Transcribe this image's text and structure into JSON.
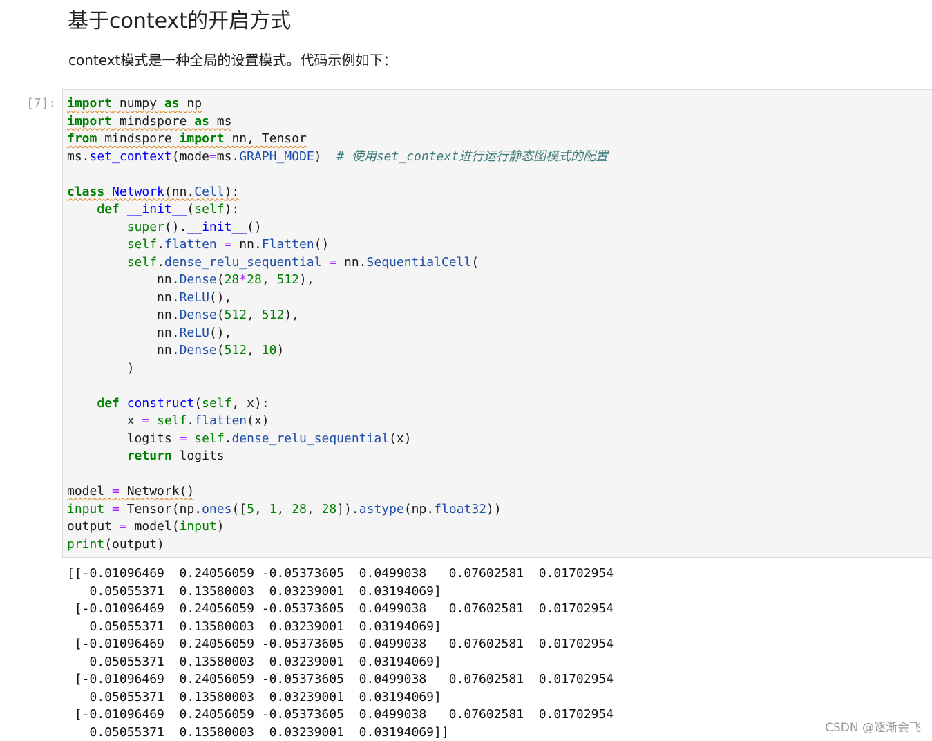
{
  "heading": "基于context的开启方式",
  "paragraph": "context模式是一种全局的设置模式。代码示例如下：",
  "cell": {
    "prompt": "[7]:",
    "lines": [
      [
        [
          "import",
          "kw sq"
        ],
        [
          " numpy ",
          "sq"
        ],
        [
          "as",
          "kw sq"
        ],
        [
          " np",
          "sq"
        ]
      ],
      [
        [
          "import",
          "kw sq"
        ],
        [
          " mindspore ",
          "sq"
        ],
        [
          "as",
          "kw sq"
        ],
        [
          " ms",
          "sq"
        ]
      ],
      [
        [
          "from",
          "kw sq"
        ],
        [
          " mindspore ",
          "sq"
        ],
        [
          "import",
          "kw sq"
        ],
        [
          " nn, Tensor",
          "sq"
        ]
      ],
      [
        [
          "ms.",
          ""
        ],
        [
          "set_context",
          "fn"
        ],
        [
          "(mode",
          ""
        ],
        [
          "=",
          "op"
        ],
        [
          "ms.",
          ""
        ],
        [
          "GRAPH_MODE",
          "at"
        ],
        [
          ")  ",
          ""
        ],
        [
          "# 使用set_context进行运行静态图模式的配置",
          "cm"
        ]
      ],
      [],
      [
        [
          "class",
          "kw sq"
        ],
        [
          " ",
          "sq"
        ],
        [
          "Network",
          "fn sq"
        ],
        [
          "(nn.",
          "sq"
        ],
        [
          "Cell",
          "at sq"
        ],
        [
          "):",
          "sq"
        ]
      ],
      [
        [
          "    ",
          ""
        ],
        [
          "def",
          "kw"
        ],
        [
          " ",
          ""
        ],
        [
          "__init__",
          "fn"
        ],
        [
          "(",
          ""
        ],
        [
          "self",
          "bi"
        ],
        [
          "):",
          ""
        ]
      ],
      [
        [
          "        ",
          ""
        ],
        [
          "super",
          "bi"
        ],
        [
          "().",
          ""
        ],
        [
          "__init__",
          "fn"
        ],
        [
          "()",
          ""
        ]
      ],
      [
        [
          "        ",
          ""
        ],
        [
          "self",
          "bi"
        ],
        [
          ".",
          ""
        ],
        [
          "flatten",
          "at"
        ],
        [
          " ",
          ""
        ],
        [
          "=",
          "op"
        ],
        [
          " nn.",
          ""
        ],
        [
          "Flatten",
          "at"
        ],
        [
          "()",
          ""
        ]
      ],
      [
        [
          "        ",
          ""
        ],
        [
          "self",
          "bi"
        ],
        [
          ".",
          ""
        ],
        [
          "dense_relu_sequential",
          "at"
        ],
        [
          " ",
          ""
        ],
        [
          "=",
          "op"
        ],
        [
          " nn.",
          ""
        ],
        [
          "SequentialCell",
          "at"
        ],
        [
          "(",
          ""
        ]
      ],
      [
        [
          "            nn.",
          ""
        ],
        [
          "Dense",
          "at"
        ],
        [
          "(",
          ""
        ],
        [
          "28",
          "nm"
        ],
        [
          "*",
          "op"
        ],
        [
          "28",
          "nm"
        ],
        [
          ", ",
          ""
        ],
        [
          "512",
          "nm"
        ],
        [
          "),",
          ""
        ]
      ],
      [
        [
          "            nn.",
          ""
        ],
        [
          "ReLU",
          "at"
        ],
        [
          "(),",
          ""
        ]
      ],
      [
        [
          "            nn.",
          ""
        ],
        [
          "Dense",
          "at"
        ],
        [
          "(",
          ""
        ],
        [
          "512",
          "nm"
        ],
        [
          ", ",
          ""
        ],
        [
          "512",
          "nm"
        ],
        [
          "),",
          ""
        ]
      ],
      [
        [
          "            nn.",
          ""
        ],
        [
          "ReLU",
          "at"
        ],
        [
          "(),",
          ""
        ]
      ],
      [
        [
          "            nn.",
          ""
        ],
        [
          "Dense",
          "at"
        ],
        [
          "(",
          ""
        ],
        [
          "512",
          "nm"
        ],
        [
          ", ",
          ""
        ],
        [
          "10",
          "nm"
        ],
        [
          ")",
          ""
        ]
      ],
      [
        [
          "        )",
          ""
        ]
      ],
      [],
      [
        [
          "    ",
          ""
        ],
        [
          "def",
          "kw"
        ],
        [
          " ",
          ""
        ],
        [
          "construct",
          "fn"
        ],
        [
          "(",
          ""
        ],
        [
          "self",
          "bi"
        ],
        [
          ", x):",
          ""
        ]
      ],
      [
        [
          "        x ",
          ""
        ],
        [
          "=",
          "op"
        ],
        [
          " ",
          ""
        ],
        [
          "self",
          "bi"
        ],
        [
          ".",
          ""
        ],
        [
          "flatten",
          "at"
        ],
        [
          "(x)",
          ""
        ]
      ],
      [
        [
          "        logits ",
          ""
        ],
        [
          "=",
          "op"
        ],
        [
          " ",
          ""
        ],
        [
          "self",
          "bi"
        ],
        [
          ".",
          ""
        ],
        [
          "dense_relu_sequential",
          "at"
        ],
        [
          "(x)",
          ""
        ]
      ],
      [
        [
          "        ",
          ""
        ],
        [
          "return",
          "kw"
        ],
        [
          " logits",
          ""
        ]
      ],
      [],
      [
        [
          "model ",
          "sq"
        ],
        [
          "=",
          "op sq"
        ],
        [
          " Network()",
          "sq"
        ]
      ],
      [
        [
          "input",
          "bi"
        ],
        [
          " ",
          ""
        ],
        [
          "=",
          "op"
        ],
        [
          " Tensor(np.",
          ""
        ],
        [
          "ones",
          "at"
        ],
        [
          "([",
          ""
        ],
        [
          "5",
          "nm"
        ],
        [
          ", ",
          ""
        ],
        [
          "1",
          "nm"
        ],
        [
          ", ",
          ""
        ],
        [
          "28",
          "nm"
        ],
        [
          ", ",
          ""
        ],
        [
          "28",
          "nm"
        ],
        [
          "]).",
          ""
        ],
        [
          "astype",
          "at"
        ],
        [
          "(np.",
          ""
        ],
        [
          "float32",
          "at"
        ],
        [
          "))",
          ""
        ]
      ],
      [
        [
          "output ",
          ""
        ],
        [
          "=",
          "op"
        ],
        [
          " model(",
          ""
        ],
        [
          "input",
          "bi"
        ],
        [
          ")",
          ""
        ]
      ],
      [
        [
          "print",
          "bi"
        ],
        [
          "(output)",
          ""
        ]
      ]
    ]
  },
  "output_text": "[[-0.01096469  0.24056059 -0.05373605  0.0499038   0.07602581  0.01702954\n   0.05055371  0.13580003  0.03239001  0.03194069]\n [-0.01096469  0.24056059 -0.05373605  0.0499038   0.07602581  0.01702954\n   0.05055371  0.13580003  0.03239001  0.03194069]\n [-0.01096469  0.24056059 -0.05373605  0.0499038   0.07602581  0.01702954\n   0.05055371  0.13580003  0.03239001  0.03194069]\n [-0.01096469  0.24056059 -0.05373605  0.0499038   0.07602581  0.01702954\n   0.05055371  0.13580003  0.03239001  0.03194069]\n [-0.01096469  0.24056059 -0.05373605  0.0499038   0.07602581  0.01702954\n   0.05055371  0.13580003  0.03239001  0.03194069]]",
  "watermark": "CSDN @逐渐会飞"
}
